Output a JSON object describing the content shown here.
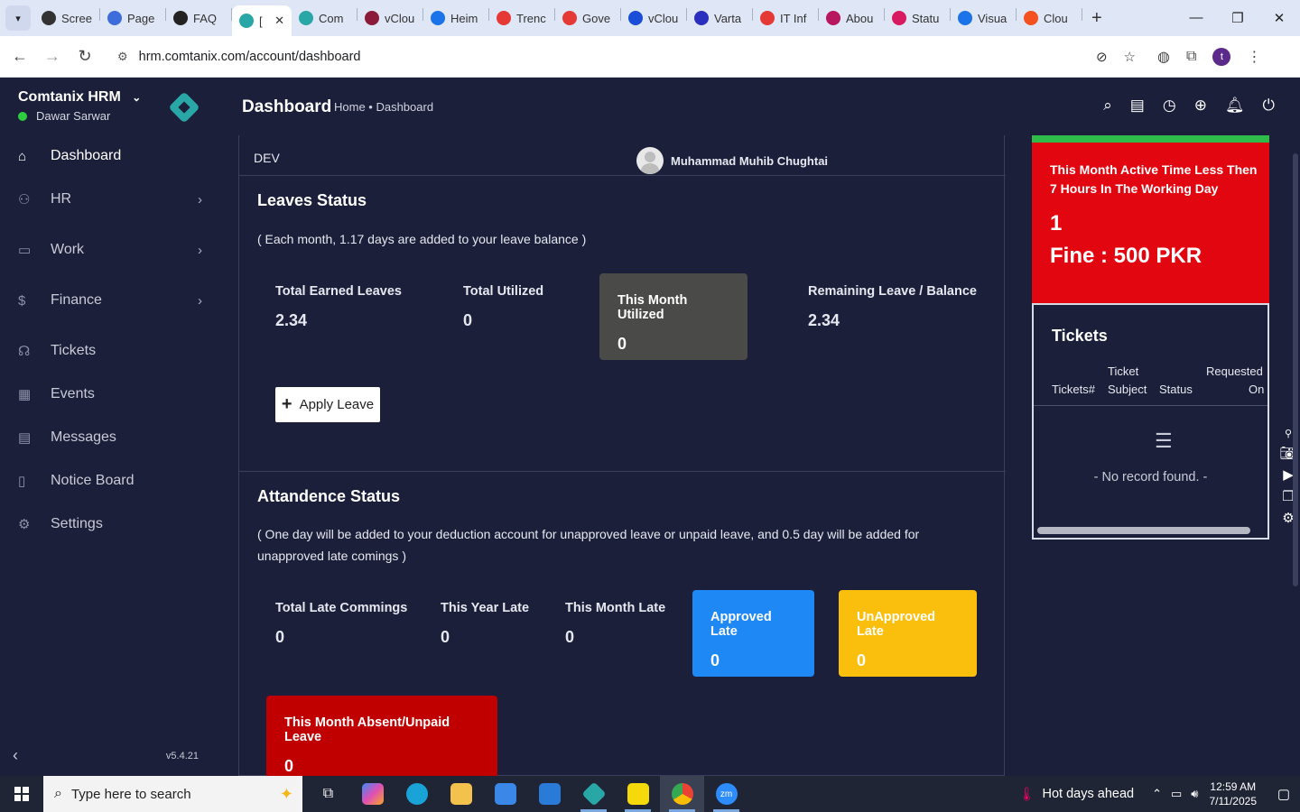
{
  "browser": {
    "tabs": [
      {
        "label": "Scree",
        "color": "#333333"
      },
      {
        "label": "Page",
        "color": "#3c6ddb"
      },
      {
        "label": "FAQ",
        "color": "#222222"
      },
      {
        "label": "[",
        "color": "#29a6a6",
        "active": true
      },
      {
        "label": "Com",
        "color": "#29a6a6"
      },
      {
        "label": "vClou",
        "color": "#8b1a3a"
      },
      {
        "label": "Heim",
        "color": "#1a73e8"
      },
      {
        "label": "Trenc",
        "color": "#e53935"
      },
      {
        "label": "Gove",
        "color": "#e53935"
      },
      {
        "label": "vClou",
        "color": "#1a4ed8"
      },
      {
        "label": "Varta",
        "color": "#2b2fbf"
      },
      {
        "label": "IT Inf",
        "color": "#e53935"
      },
      {
        "label": "Abou",
        "color": "#b8165e"
      },
      {
        "label": "Statu",
        "color": "#d81b60"
      },
      {
        "label": "Visua",
        "color": "#1a73e8"
      },
      {
        "label": "Clou",
        "color": "#f4511e"
      }
    ],
    "url": "hrm.comtanix.com/account/dashboard",
    "profile_initial": "t"
  },
  "sidebar": {
    "brand": "Comtanix HRM",
    "user": "Dawar Sarwar",
    "items": [
      {
        "label": "Dashboard",
        "icon": "home-icon",
        "active": true,
        "arrow": false
      },
      {
        "label": "HR",
        "icon": "users-icon",
        "arrow": true
      },
      {
        "label": "Work",
        "icon": "briefcase-icon",
        "arrow": true
      },
      {
        "label": "Finance",
        "icon": "dollar-icon",
        "arrow": true
      },
      {
        "label": "Tickets",
        "icon": "headset-icon",
        "arrow": false
      },
      {
        "label": "Events",
        "icon": "calendar-icon",
        "arrow": false
      },
      {
        "label": "Messages",
        "icon": "message-icon",
        "arrow": false
      },
      {
        "label": "Notice Board",
        "icon": "clipboard-icon",
        "arrow": false
      },
      {
        "label": "Settings",
        "icon": "gear-icon",
        "arrow": false
      }
    ],
    "version": "v5.4.21"
  },
  "header": {
    "title": "Dashboard",
    "breadcrumb": "Home • Dashboard"
  },
  "main": {
    "dept": "DEV",
    "employee": "Muhammad Muhib Chughtai",
    "leaves": {
      "title": "Leaves Status",
      "note": "( Each month, 1.17 days are added to your leave balance )",
      "total_earned_label": "Total Earned Leaves",
      "total_earned": "2.34",
      "total_utilized_label": "Total Utilized",
      "total_utilized": "0",
      "month_utilized_label": "This Month Utilized",
      "month_utilized": "0",
      "remaining_label": "Remaining Leave / Balance",
      "remaining": "2.34",
      "apply_label": "Apply Leave"
    },
    "attendance": {
      "title": "Attandence Status",
      "note": "( One day will be added to your deduction account for unapproved leave or unpaid leave, and 0.5 day will be added for unapproved late comings )",
      "late_label": "Total Late Commings",
      "late": "0",
      "year_late_label": "This Year Late",
      "year_late": "0",
      "month_late_label": "This Month Late",
      "month_late": "0",
      "approved_label": "Approved Late",
      "approved": "0",
      "unapproved_label": "UnApproved Late",
      "unapproved": "0",
      "absent_label": "This Month Absent/Unpaid Leave",
      "absent": "0"
    }
  },
  "right": {
    "fine_msg": "This Month Active Time Less Then 7 Hours In The Working Day",
    "fine_count": "1",
    "fine_amount": "Fine : 500 PKR",
    "tickets_title": "Tickets",
    "col_tickets": "Tickets#",
    "col_subject_1": "Ticket",
    "col_subject_2": "Subject",
    "col_status": "Status",
    "col_requested_1": "Requested",
    "col_requested_2": "On",
    "empty": "- No record found. -"
  },
  "taskbar": {
    "search_placeholder": "Type here to search",
    "weather": "Hot days ahead",
    "time": "12:59 AM",
    "date": "7/11/2025"
  },
  "colors": {
    "bg": "#1b1f3a",
    "fine_red": "#e10610",
    "absent_red": "#c00000",
    "approved_blue": "#1e88f5",
    "unapproved_yellow": "#f9bf0c",
    "month_card": "#4a4a48"
  }
}
